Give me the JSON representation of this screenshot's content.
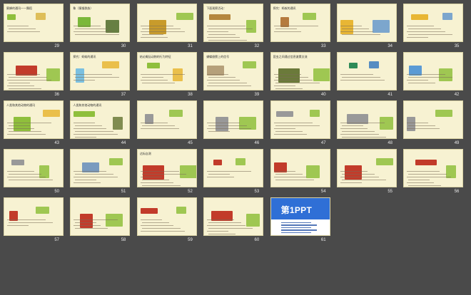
{
  "slides": [
    {
      "num": "29",
      "title": "蜜蜂的通讯——舞蹈",
      "colors": [
        "#8fbf3c",
        "#d9b544"
      ]
    },
    {
      "num": "30",
      "title": "象（猿猴群族）",
      "colors": [
        "#7bb83a",
        "#4d6b2a"
      ]
    },
    {
      "num": "31",
      "title": "",
      "colors": [
        "#c89b2b",
        "#8fbf3c"
      ]
    },
    {
      "num": "32",
      "title": "下面观察活动：",
      "colors": [
        "#b5873e",
        "#8fbf3c"
      ]
    },
    {
      "num": "33",
      "title": "探究：蚂蚁的通讯",
      "colors": [
        "#b57b3e",
        "#8fbf3c"
      ]
    },
    {
      "num": "34",
      "title": "",
      "colors": [
        "#e8b634",
        "#6699cc"
      ]
    },
    {
      "num": "35",
      "title": "",
      "colors": [
        "#e8b634",
        "#6699cc"
      ]
    },
    {
      "num": "36",
      "title": "",
      "colors": [
        "#c23b2a",
        "#8fbf3c"
      ]
    },
    {
      "num": "37",
      "title": "探究：蚂蚁的通讯",
      "colors": [
        "#7bc0e0",
        "#e8b634"
      ]
    },
    {
      "num": "38",
      "title": "结论概括动物的行为特征",
      "colors": [
        "#8fbf3c",
        "#e8b634"
      ]
    },
    {
      "num": "39",
      "title": "蝴蝶翅膀上的信号",
      "colors": [
        "#b5a07a",
        "#8fbf3c"
      ]
    },
    {
      "num": "40",
      "title": "昆虫之间通过信息激素交流",
      "colors": [
        "#6b7a3a",
        "#8fbf3c"
      ]
    },
    {
      "num": "41",
      "title": "",
      "colors": [
        "#2e8b57",
        "#3a7bbf"
      ]
    },
    {
      "num": "42",
      "title": "",
      "colors": [
        "#5b9bd5",
        "#8fbf3c"
      ]
    },
    {
      "num": "43",
      "title": "人类和其他动物的通讯",
      "colors": [
        "#8fbf3c",
        "#e8b634"
      ]
    },
    {
      "num": "44",
      "title": "人类和其他动物的通讯",
      "colors": [
        "#8fbf3c",
        "#6b7a3a"
      ]
    },
    {
      "num": "45",
      "title": "",
      "colors": [
        "#999999",
        "#8fbf3c"
      ]
    },
    {
      "num": "46",
      "title": "",
      "colors": [
        "#999999",
        "#8fbf3c"
      ]
    },
    {
      "num": "47",
      "title": "",
      "colors": [
        "#999999",
        "#8fbf3c"
      ]
    },
    {
      "num": "48",
      "title": "",
      "colors": [
        "#999999",
        "#8fbf3c"
      ]
    },
    {
      "num": "49",
      "title": "",
      "colors": [
        "#999999",
        "#8fbf3c"
      ]
    },
    {
      "num": "50",
      "title": "",
      "colors": [
        "#999999",
        "#8fbf3c"
      ]
    },
    {
      "num": "51",
      "title": "",
      "colors": [
        "#7a9bbf",
        "#8fbf3c"
      ]
    },
    {
      "num": "52",
      "title": "达标自测",
      "colors": [
        "#c23b2a",
        "#8fbf3c"
      ]
    },
    {
      "num": "53",
      "title": "",
      "colors": [
        "#c23b2a",
        "#8fbf3c"
      ]
    },
    {
      "num": "54",
      "title": "",
      "colors": [
        "#c23b2a",
        "#8fbf3c"
      ]
    },
    {
      "num": "55",
      "title": "",
      "colors": [
        "#c23b2a",
        "#8fbf3c"
      ]
    },
    {
      "num": "56",
      "title": "",
      "colors": [
        "#c23b2a",
        "#8fbf3c"
      ]
    },
    {
      "num": "57",
      "title": "",
      "colors": [
        "#c23b2a",
        "#8fbf3c"
      ]
    },
    {
      "num": "58",
      "title": "",
      "colors": [
        "#c23b2a",
        "#8fbf3c"
      ]
    },
    {
      "num": "59",
      "title": "",
      "colors": [
        "#c23b2a",
        "#8fbf3c"
      ]
    },
    {
      "num": "60",
      "title": "",
      "colors": [
        "#c23b2a",
        "#8fbf3c"
      ]
    },
    {
      "num": "61",
      "title": "第1PPT",
      "colors": [
        "#2f6fd6",
        "#1b4aa0"
      ]
    }
  ],
  "accent": "#f7f2d2"
}
